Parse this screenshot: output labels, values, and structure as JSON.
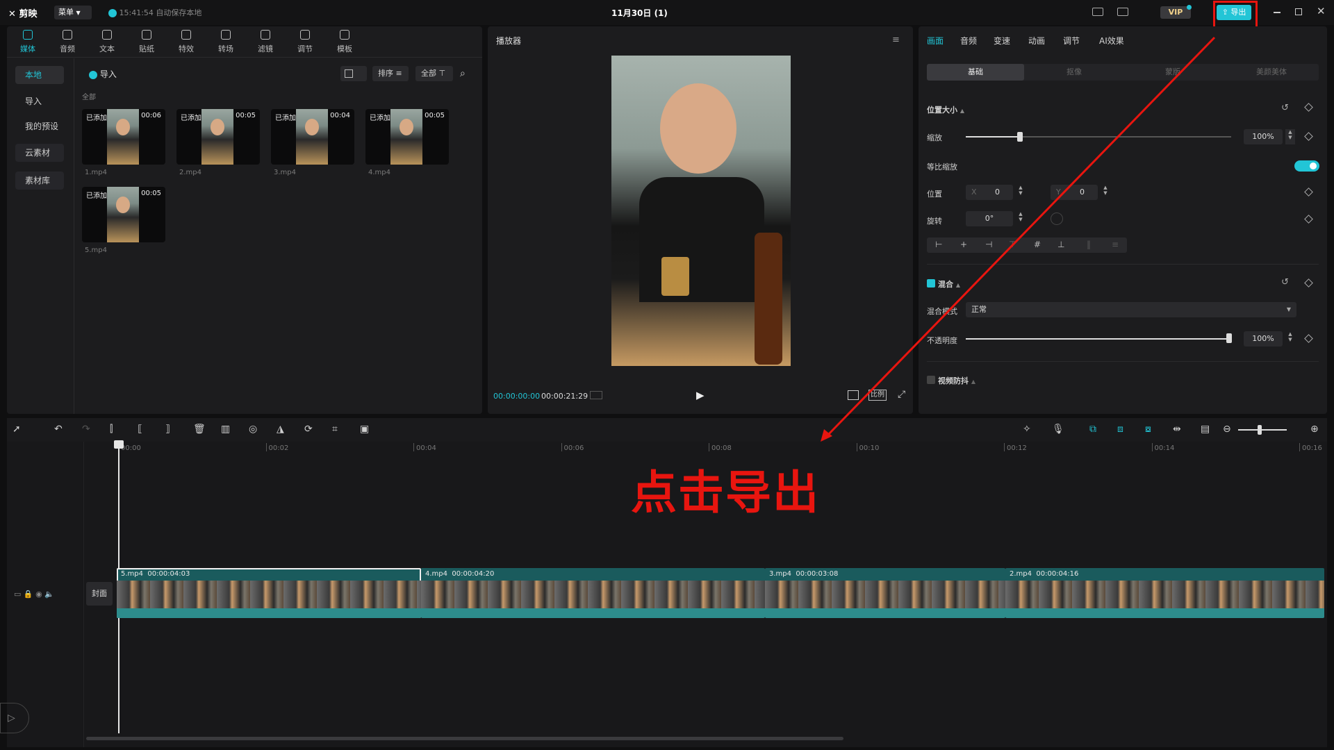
{
  "app": {
    "logo": "剪映",
    "menu": "菜单",
    "autosave": "15:41:54 自动保存本地",
    "project_title": "11月30日 (1)",
    "vip": "VIP",
    "export": "导出"
  },
  "toolbar": [
    {
      "label": "媒体",
      "icon": "media-icon"
    },
    {
      "label": "音频",
      "icon": "audio-icon"
    },
    {
      "label": "文本",
      "icon": "text-icon"
    },
    {
      "label": "贴纸",
      "icon": "sticker-icon"
    },
    {
      "label": "特效",
      "icon": "effects-icon"
    },
    {
      "label": "转场",
      "icon": "transition-icon"
    },
    {
      "label": "滤镜",
      "icon": "filter-icon"
    },
    {
      "label": "调节",
      "icon": "adjust-icon"
    },
    {
      "label": "模板",
      "icon": "template-icon"
    }
  ],
  "sidebar": [
    "本地",
    "导入",
    "我的预设",
    "云素材",
    "素材库"
  ],
  "media": {
    "import": "导入",
    "sort": "排序",
    "filter": "全部",
    "section": "全部",
    "items": [
      {
        "tag": "已添加",
        "dur": "00:06",
        "name": "1.mp4"
      },
      {
        "tag": "已添加",
        "dur": "00:05",
        "name": "2.mp4"
      },
      {
        "tag": "已添加",
        "dur": "00:04",
        "name": "3.mp4"
      },
      {
        "tag": "已添加",
        "dur": "00:05",
        "name": "4.mp4"
      },
      {
        "tag": "已添加",
        "dur": "00:05",
        "name": "5.mp4"
      }
    ]
  },
  "player": {
    "title": "播放器",
    "current": "00:00:00:00",
    "total": "00:00:21:29",
    "ratio": "比例"
  },
  "props": {
    "tabs": [
      "画面",
      "音频",
      "变速",
      "动画",
      "调节",
      "AI效果"
    ],
    "subtabs": [
      "基础",
      "抠像",
      "蒙版",
      "美颜美体"
    ],
    "pos_size": "位置大小",
    "scale": "缩放",
    "scale_val": "100%",
    "uniform": "等比缩放",
    "position": "位置",
    "x_label": "X",
    "x_val": "0",
    "y_label": "Y",
    "y_val": "0",
    "rotate": "旋转",
    "rotate_val": "0°",
    "blend": "混合",
    "blend_mode": "混合模式",
    "blend_mode_val": "正常",
    "opacity": "不透明度",
    "opacity_val": "100%",
    "stabilize": "视频防抖"
  },
  "timeline": {
    "ruler": [
      "00:00",
      "00:02",
      "00:04",
      "00:06",
      "00:08",
      "00:10",
      "00:12",
      "00:14",
      "00:16"
    ],
    "cover": "封面",
    "clips": [
      {
        "name": "5.mp4",
        "dur": "00:00:04:03"
      },
      {
        "name": "4.mp4",
        "dur": "00:00:04:20"
      },
      {
        "name": "3.mp4",
        "dur": "00:00:03:08"
      },
      {
        "name": "2.mp4",
        "dur": "00:00:04:16"
      }
    ]
  },
  "annotation": {
    "text": "点击导出",
    "color": "#e8150f"
  },
  "colors": {
    "accent": "#22c5d6",
    "annotation": "#e8150f"
  }
}
